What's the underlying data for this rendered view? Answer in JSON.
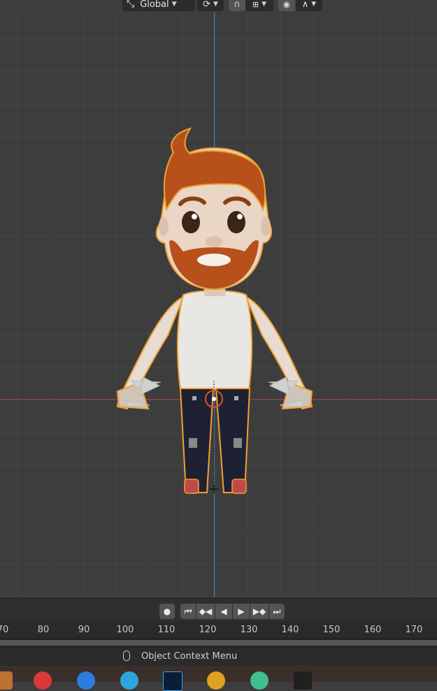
{
  "header": {
    "orientation_label": "Global",
    "transform_icon": "transform-orientation-icon",
    "pivot_icon": "pivot-icon",
    "snap_icon": "snap-magnet-icon",
    "snap_increment_icon": "snap-increment-icon",
    "proportional_icon": "proportional-editing-icon",
    "falloff_icon": "falloff-curve-icon"
  },
  "viewport": {
    "grid_color": "#464646",
    "background": "#3d3d3d",
    "axis_x_color": "#a14040",
    "axis_y_color": "#3f7ed0",
    "selection_outline": "#f0a030"
  },
  "playback": {
    "record_icon": "record-icon",
    "jump_start_icon": "jump-to-start-icon",
    "prev_keyframe_icon": "prev-keyframe-icon",
    "play_reverse_icon": "play-reverse-icon",
    "play_icon": "play-icon",
    "next_keyframe_icon": "next-keyframe-icon",
    "jump_end_icon": "jump-to-end-icon"
  },
  "timeline": {
    "ticks": [
      "70",
      "80",
      "90",
      "100",
      "110",
      "120",
      "130",
      "140",
      "150",
      "160",
      "170"
    ]
  },
  "status": {
    "mouse_icon": "mouse-right-icon",
    "context_label": "Object Context Menu"
  },
  "taskbar": {
    "apps": [
      "app-1",
      "app-2",
      "app-3",
      "telegram",
      "photoshop",
      "app-6",
      "app-7",
      "app-8"
    ]
  }
}
